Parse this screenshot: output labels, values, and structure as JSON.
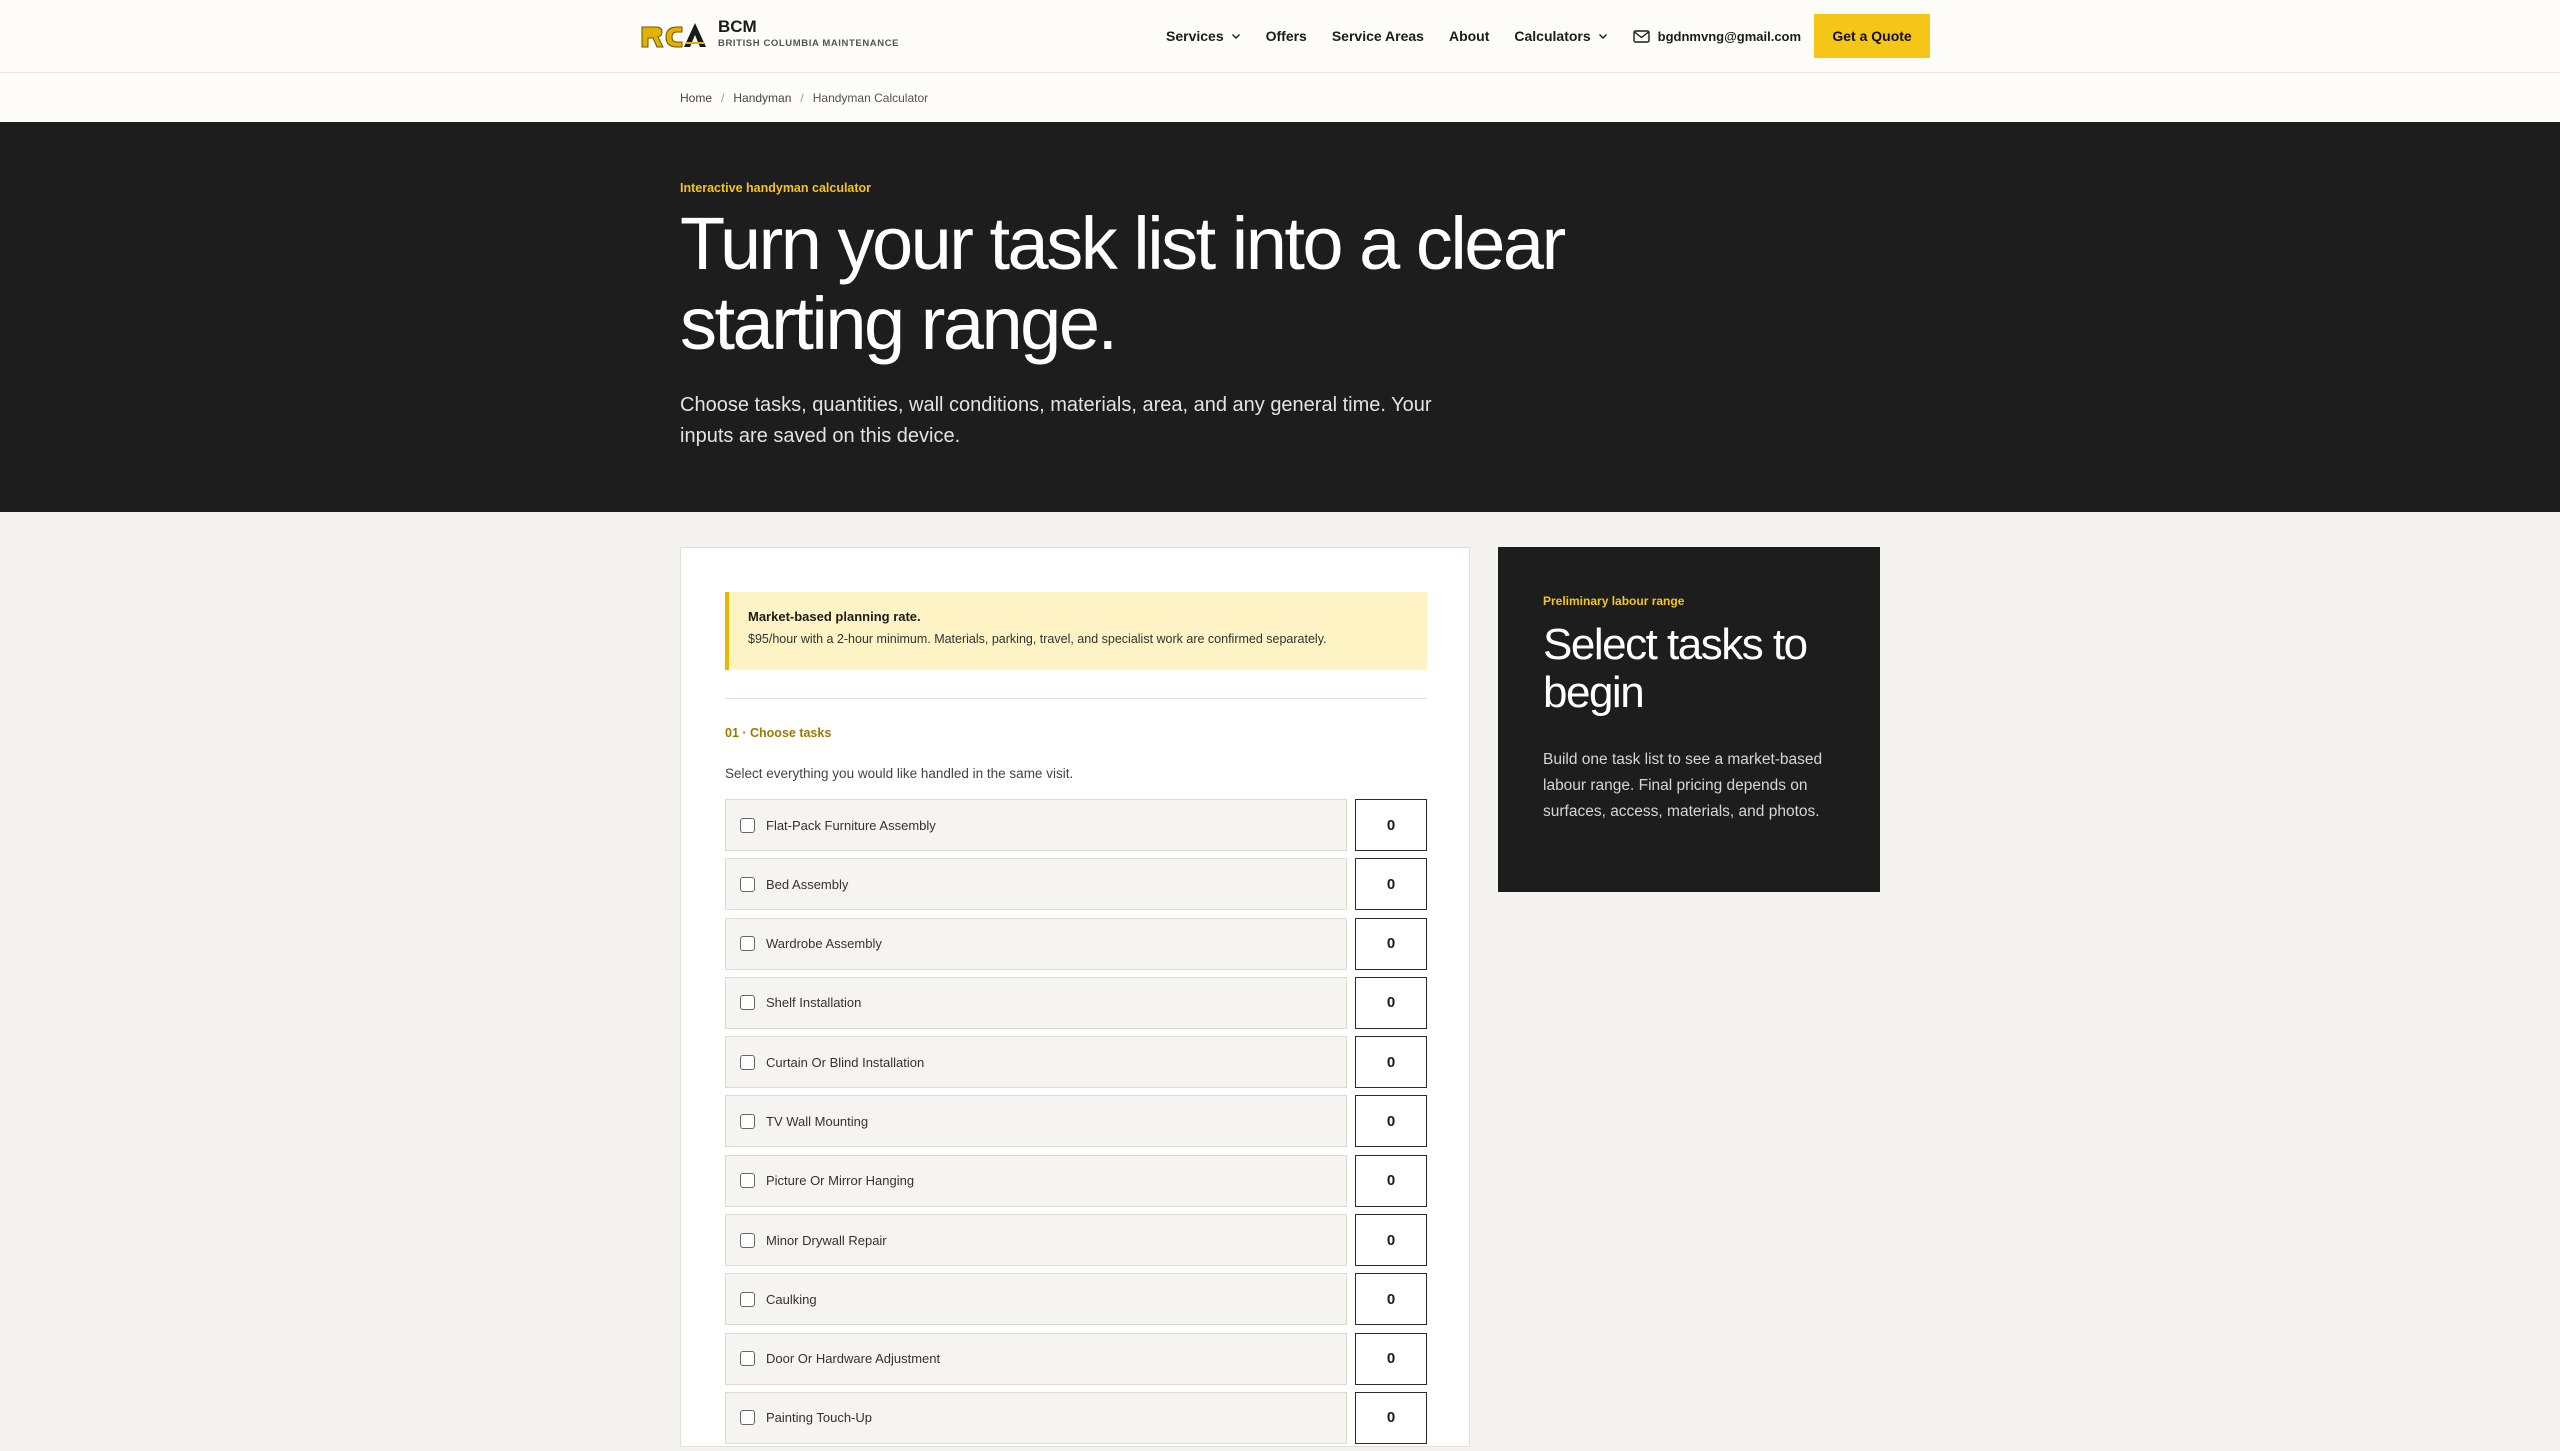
{
  "brand": {
    "name": "BCM",
    "subtitle": "BRITISH COLUMBIA MAINTENANCE"
  },
  "nav": {
    "services": "Services",
    "offers": "Offers",
    "service_areas": "Service Areas",
    "about": "About",
    "calculators": "Calculators",
    "email": "bgdnmvng@gmail.com",
    "cta": "Get a Quote"
  },
  "breadcrumb": [
    "Home",
    "Handyman",
    "Handyman Calculator"
  ],
  "hero": {
    "eyebrow": "Interactive handyman calculator",
    "title": "Turn your task list into a clear starting range.",
    "subtitle": "Choose tasks, quantities, wall conditions, materials, area, and any general time. Your inputs are saved on this device."
  },
  "notice": {
    "title": "Market-based planning rate.",
    "body": "$95/hour with a 2-hour minimum. Materials, parking, travel, and specialist work are confirmed separately."
  },
  "step": {
    "label": "01 · Choose tasks",
    "description": "Select everything you would like handled in the same visit."
  },
  "tasks": [
    {
      "label": "Flat-Pack Furniture Assembly",
      "qty": "0"
    },
    {
      "label": "Bed Assembly",
      "qty": "0"
    },
    {
      "label": "Wardrobe Assembly",
      "qty": "0"
    },
    {
      "label": "Shelf Installation",
      "qty": "0"
    },
    {
      "label": "Curtain Or Blind Installation",
      "qty": "0"
    },
    {
      "label": "TV Wall Mounting",
      "qty": "0"
    },
    {
      "label": "Picture Or Mirror Hanging",
      "qty": "0"
    },
    {
      "label": "Minor Drywall Repair",
      "qty": "0"
    },
    {
      "label": "Caulking",
      "qty": "0"
    },
    {
      "label": "Door Or Hardware Adjustment",
      "qty": "0"
    },
    {
      "label": "Painting Touch-Up",
      "qty": "0"
    }
  ],
  "summary": {
    "eyebrow": "Preliminary labour range",
    "title": "Select tasks to begin",
    "body": "Build one task list to see a market-based labour range. Final pricing depends on surfaces, access, materials, and photos."
  },
  "colors": {
    "accent": "#f5c518",
    "dark": "#1d1d1d",
    "notice_bg": "#fdf3c4"
  },
  "icons": {
    "nav_dropdown": "chevron-down-icon",
    "email": "mail-icon",
    "logo": "bcm-logo-icon"
  }
}
